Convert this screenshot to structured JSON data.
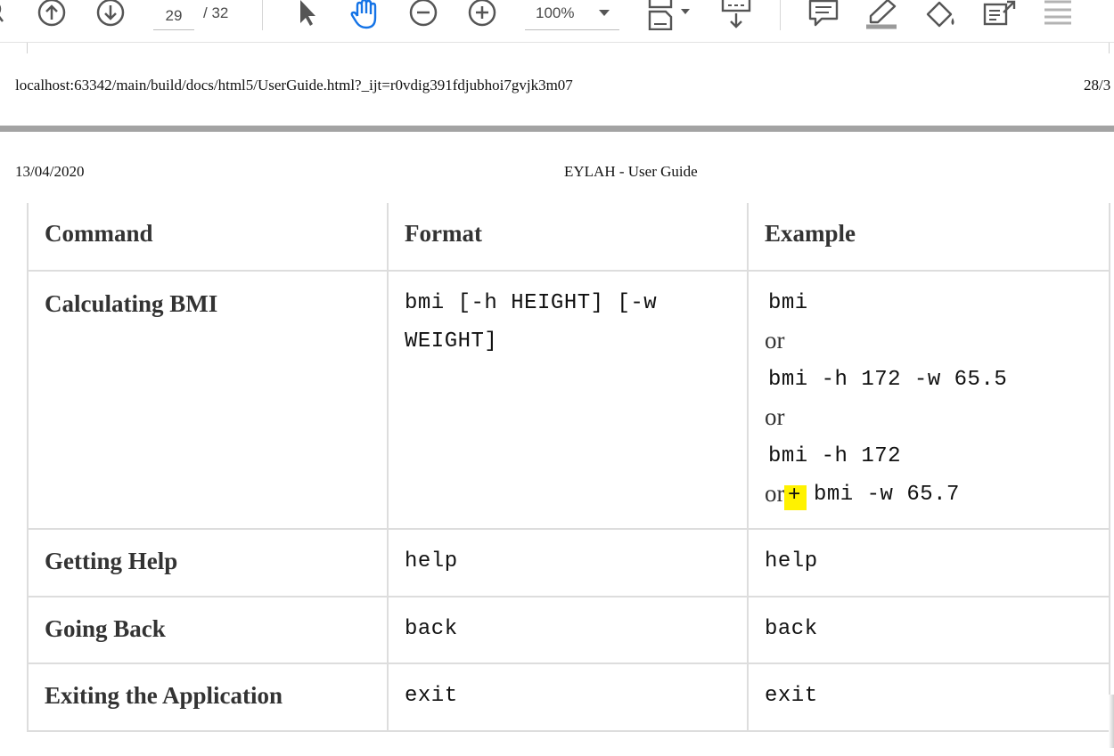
{
  "toolbar": {
    "page_current": "29",
    "page_total": "/  32",
    "zoom": "100%"
  },
  "prev_page": {
    "footer_url": "localhost:63342/main/build/docs/html5/UserGuide.html?_ijt=r0vdig391fdjubhoi7gvjk3m07",
    "footer_page": "28/3"
  },
  "page": {
    "date": "13/04/2020",
    "title": "EYLAH - User Guide"
  },
  "table": {
    "headers": [
      "Command",
      "Format",
      "Example"
    ],
    "rows": [
      {
        "name": "Calculating BMI",
        "format_line1": "bmi [-h HEIGHT] [-w",
        "format_line2": "WEIGHT]",
        "example_1": "bmi",
        "or_1": "or",
        "example_2": "bmi -h 172 -w 65.5",
        "or_2": "or",
        "example_3": "bmi -h 172",
        "or_3": "or",
        "plus": "+",
        "example_4": "bmi -w 65.7"
      },
      {
        "name": "Getting Help",
        "format": "help",
        "example": "help"
      },
      {
        "name": "Going Back",
        "format": "back",
        "example": "back"
      },
      {
        "name": "Exiting the Application",
        "format": "exit",
        "example": "exit"
      }
    ]
  },
  "colors": {
    "highlight": "#fff200",
    "accent_hand": "#1473e6",
    "page_gap": "#a3a3a3"
  }
}
